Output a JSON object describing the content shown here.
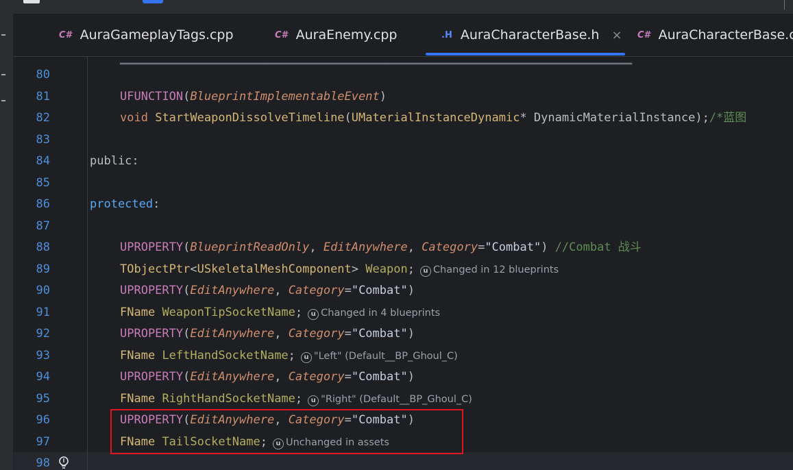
{
  "tabs": [
    {
      "icon": "C#",
      "icon_type": "cpp",
      "label": "AuraGameplayTags.cpp",
      "active": false
    },
    {
      "icon": "C#",
      "icon_type": "cpp",
      "label": "AuraEnemy.cpp",
      "active": false
    },
    {
      "icon": ".H",
      "icon_type": "h",
      "label": "AuraCharacterBase.h",
      "active": true,
      "close": "×"
    },
    {
      "icon": "C#",
      "icon_type": "cpp",
      "label": "AuraCharacterBase.cpp",
      "active": false
    }
  ],
  "lines": [
    {
      "n": "80"
    },
    {
      "n": "81"
    },
    {
      "n": "82"
    },
    {
      "n": "83"
    },
    {
      "n": "84"
    },
    {
      "n": "85"
    },
    {
      "n": "86"
    },
    {
      "n": "87"
    },
    {
      "n": "88"
    },
    {
      "n": "89"
    },
    {
      "n": "90"
    },
    {
      "n": "91"
    },
    {
      "n": "92"
    },
    {
      "n": "93"
    },
    {
      "n": "94"
    },
    {
      "n": "95"
    },
    {
      "n": "96"
    },
    {
      "n": "97"
    },
    {
      "n": "98"
    }
  ],
  "code": {
    "l81_macro": "UFUNCTION",
    "l81_spec": "BlueprintImplementableEvent",
    "l82_void": "void",
    "l82_fn": "StartWeaponDissolveTimeline",
    "l82_type": "UMaterialInstanceDynamic",
    "l82_param": "DynamicMaterialInstance",
    "l82_cmt": "/*蓝图",
    "l84": "public:",
    "l86": "protected",
    "l88_macro": "UPROPERTY",
    "l88_spec1": "BlueprintReadOnly",
    "l88_spec2": "EditAnywhere",
    "l88_spec3": "Category",
    "l88_str": "\"Combat\"",
    "l88_cmt": "//Combat 战斗",
    "l89_type1": "TObjectPtr",
    "l89_type2": "USkeletalMeshComponent",
    "l89_var": "Weapon",
    "l90_macro": "UPROPERTY",
    "spec_edit": "EditAnywhere",
    "spec_cat": "Category",
    "str_combat": "\"Combat\"",
    "type_fname": "FName",
    "l91_var": "WeaponTipSocketName",
    "l93_var": "LeftHandSocketName",
    "l95_var": "RightHandSocketName",
    "l97_var": "TailSocketName"
  },
  "hints": {
    "u_glyph": "u",
    "l89": "Changed in 12 blueprints",
    "l91": "Changed in 4 blueprints",
    "l93": "\"Left\" (Default__BP_Ghoul_C)",
    "l95": "\"Right\" (Default__BP_Ghoul_C)",
    "l97": "Unchanged in assets"
  },
  "colors": {
    "background": "#1e1f22",
    "line_number": "#4e8fd9",
    "keyword": "#cf8e6d",
    "macro": "#c77dbb",
    "type": "#d5b778",
    "comment": "#5f8c56",
    "active_tab_underline": "#3574f0",
    "highlight_box": "#e0161f"
  }
}
